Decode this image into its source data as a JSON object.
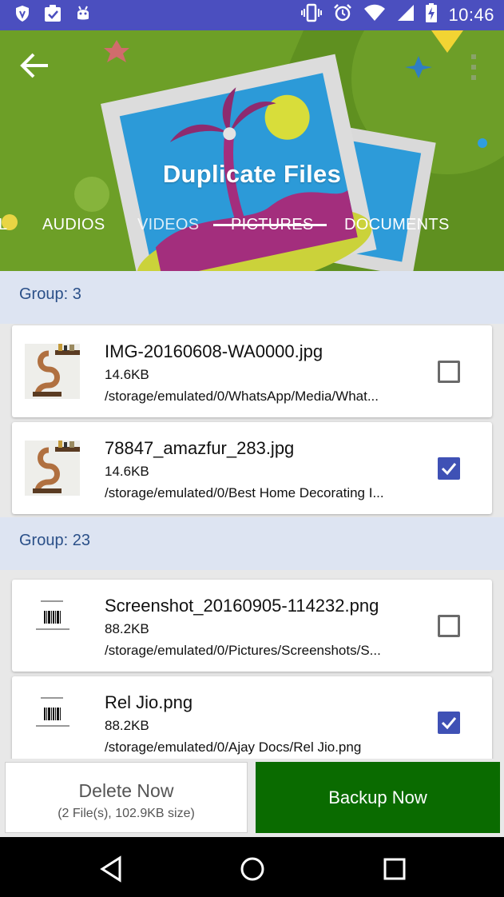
{
  "status_bar": {
    "time": "10:46",
    "left_icons": [
      "shield-icon",
      "clipboard-check-icon",
      "android-icon"
    ],
    "right_icons": [
      "vibrate-icon",
      "alarm-icon",
      "wifi-icon",
      "signal-icon",
      "battery-charging-icon"
    ]
  },
  "header": {
    "title": "Duplicate Files",
    "back_icon": "arrow-back-icon",
    "menu_icon": "overflow-menu-icon",
    "tabs": [
      {
        "label": "L",
        "selected": false
      },
      {
        "label": "AUDIOS",
        "selected": false
      },
      {
        "label": "VIDEOS",
        "selected": false
      },
      {
        "label": "PICTURES",
        "selected": true
      },
      {
        "label": "DOCUMENTS",
        "selected": false
      }
    ],
    "color": "#6d9f27"
  },
  "groups": [
    {
      "label": "Group: 3",
      "files": [
        {
          "name": "IMG-20160608-WA0000.jpg",
          "size": "14.6KB",
          "path": "/storage/emulated/0/WhatsApp/Media/What...",
          "checked": false,
          "thumb": "shelf-photo"
        },
        {
          "name": "78847_amazfur_283.jpg",
          "size": "14.6KB",
          "path": "/storage/emulated/0/Best Home Decorating I...",
          "checked": true,
          "thumb": "shelf-photo"
        }
      ]
    },
    {
      "label": "Group: 23",
      "files": [
        {
          "name": "Screenshot_20160905-114232.png",
          "size": "88.2KB",
          "path": "/storage/emulated/0/Pictures/Screenshots/S...",
          "checked": false,
          "thumb": "barcode-document"
        },
        {
          "name": "Rel Jio.png",
          "size": "88.2KB",
          "path": "/storage/emulated/0/Ajay Docs/Rel Jio.png",
          "checked": true,
          "thumb": "barcode-document"
        }
      ]
    }
  ],
  "actions": {
    "delete_label": "Delete Now",
    "delete_sub": "(2 File(s), 102.9KB size)",
    "backup_label": "Backup Now",
    "backup_color": "#0a6b00"
  },
  "nav": {
    "back_icon": "nav-back-icon",
    "home_icon": "nav-home-icon",
    "recents_icon": "nav-recents-icon"
  },
  "colors": {
    "status_bar": "#4b4fbf",
    "group_header_bg": "#dde4f2",
    "group_label": "#2a4f88",
    "checkbox_checked": "#3f51b5"
  }
}
